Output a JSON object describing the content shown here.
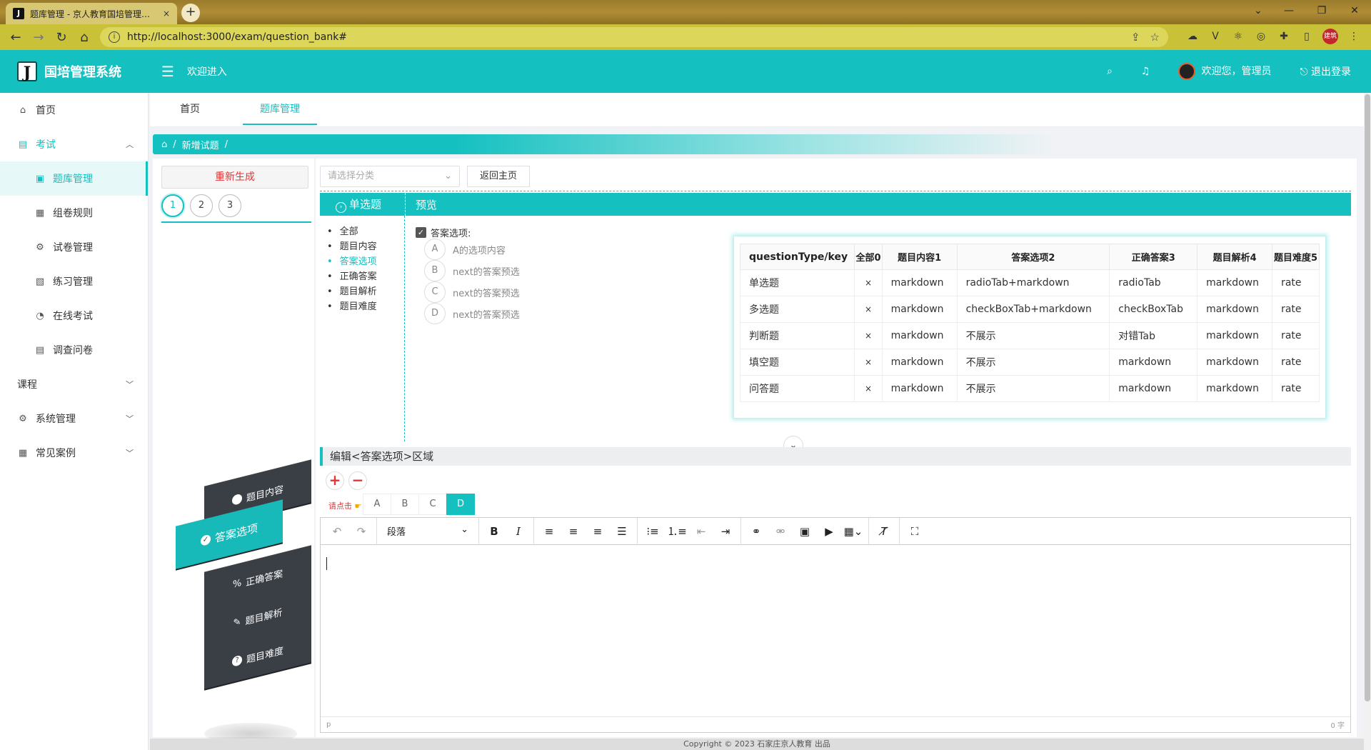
{
  "browser": {
    "tab_title": "题库管理 - 京人教育国培管理系统",
    "tab_close": "×",
    "new_tab": "+",
    "url": "http://localhost:3000/exam/question_bank#",
    "profile_label": "建筑"
  },
  "header": {
    "logo_letter": "J",
    "app_name": "国培管理系统",
    "menu_icon": "☰",
    "welcome": "欢迎进入",
    "user_greeting": "欢迎您，管理员",
    "logout": "退出登录"
  },
  "sidebar": {
    "items": [
      {
        "label": "首页",
        "icon": "home-icon"
      },
      {
        "label": "考试",
        "icon": "exam-icon"
      },
      {
        "label": "题库管理",
        "icon": "question-bank-icon"
      },
      {
        "label": "组卷规则",
        "icon": "rules-icon"
      },
      {
        "label": "试卷管理",
        "icon": "gear-icon"
      },
      {
        "label": "练习管理",
        "icon": "practice-icon"
      },
      {
        "label": "在线考试",
        "icon": "wifi-icon"
      },
      {
        "label": "调查问卷",
        "icon": "survey-icon"
      },
      {
        "label": "课程",
        "icon": ""
      },
      {
        "label": "系统管理",
        "icon": "gear-icon"
      },
      {
        "label": "常见案例",
        "icon": "case-icon"
      }
    ]
  },
  "tabs": [
    {
      "label": "首页"
    },
    {
      "label": "题库管理"
    }
  ],
  "breadcrumb": {
    "current": "新增试题",
    "sep": "/"
  },
  "question_panel": {
    "regen_label": "重新生成",
    "numbers": [
      "1",
      "2",
      "3"
    ],
    "active_number": "1",
    "blocks": [
      "题目内容",
      "答案选项",
      "正确答案",
      "题目解析",
      "题目难度"
    ]
  },
  "main": {
    "category_placeholder": "请选择分类",
    "back_label": "返回主页",
    "question_type": "单选题",
    "preview_label": "预览",
    "fields": [
      "全部",
      "题目内容",
      "答案选项",
      "正确答案",
      "题目解析",
      "题目难度"
    ],
    "active_field": "答案选项",
    "options_title": "答案选项:",
    "options": [
      {
        "letter": "A",
        "text": "A的选项内容"
      },
      {
        "letter": "B",
        "text": "next的答案预选"
      },
      {
        "letter": "C",
        "text": "next的答案预选"
      },
      {
        "letter": "D",
        "text": "next的答案预选"
      }
    ],
    "table": {
      "headers": [
        "questionType/key",
        "全部0",
        "题目内容1",
        "答案选项2",
        "正确答案3",
        "题目解析4",
        "题目难度5"
      ],
      "rows": [
        [
          "单选题",
          "×",
          "markdown",
          "radioTab+markdown",
          "radioTab",
          "markdown",
          "rate"
        ],
        [
          "多选题",
          "×",
          "markdown",
          "checkBoxTab+markdown",
          "checkBoxTab",
          "markdown",
          "rate"
        ],
        [
          "判断题",
          "×",
          "markdown",
          "不展示",
          "对错Tab",
          "markdown",
          "rate"
        ],
        [
          "填空题",
          "×",
          "markdown",
          "不展示",
          "markdown",
          "markdown",
          "rate"
        ],
        [
          "问答题",
          "×",
          "markdown",
          "不展示",
          "markdown",
          "markdown",
          "rate"
        ]
      ]
    },
    "edit_title": "编辑<答案选项>区域",
    "click_hint": "请点击",
    "option_tabs": [
      "A",
      "B",
      "C",
      "D"
    ],
    "active_option_tab": "D",
    "paragraph_select": "段落",
    "status_left": "p",
    "status_right": "0 字"
  },
  "footer": {
    "copyright": "Copyright © 2023 石家庄京人教育 出品"
  },
  "colors": {
    "primary": "#14c0c0",
    "danger": "#e03535"
  }
}
